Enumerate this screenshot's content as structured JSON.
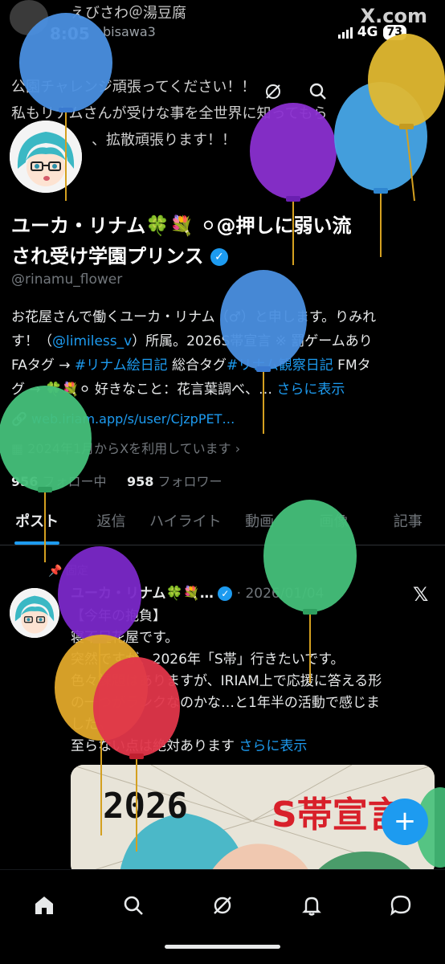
{
  "status_bar": {
    "time": "8:05",
    "network": "4G",
    "battery": "73"
  },
  "banner": {
    "name": "えびさわ＠湯豆腐",
    "handle": "bisawa3",
    "site": "X.com"
  },
  "quote_lines": [
    "公園チャレンジ頑張ってください！！",
    "私もリナムさんが受けな事を全世界に知ってもら",
    "、拡散頑張ります！！"
  ],
  "profile": {
    "name_lines": [
      "ユーカ・リナム🍀💐 ⚪︎@押しに弱い流",
      "され受け学園プリンス"
    ],
    "handle": "@rinamu_flower",
    "bio": {
      "line1": "お花屋さんで働くユーカ・リナム（♂）と申します。りみれ",
      "line2a": "す！（",
      "line2_link": "@limiless_v",
      "line2b": "）所属。2026S帯宣言 ※ 罰ゲームあり",
      "line3a": "FAタグ → ",
      "line3_tag1": "#リナム絵日記",
      "line3b": " 総合タグ",
      "line3_tag2": "#リナム観察日記",
      "line3c": " FMタ",
      "line4a": "グ → 🍀💐⚪︎ 好きなこと：花言葉調べ、… ",
      "more": "さらに表示"
    },
    "url": "web.iriam.app/s/user/CjzpPET…",
    "joined": "2024年1月からXを利用しています",
    "following_count": "956",
    "following_label": "フォロー中",
    "followers_count": "958",
    "followers_label": "フォロワー"
  },
  "tabs": [
    "ポスト",
    "返信",
    "ハイライト",
    "動画",
    "画像",
    "記事"
  ],
  "post": {
    "pinned_label": "固定",
    "author": "ユーカ・リナム🍀💐…",
    "date": "· 2026/01/04",
    "body_lines": [
      "【今年の抱負】",
      "寝不足花屋です。",
      "突然ですが、2026年「S帯」行きたいです。",
      "色々課題はありますが、IRIAM上で応援に答える形",
      "の一つがランクなのかな…と1年半の活動で感じま",
      "した。"
    ],
    "last_line": "至らない点は絶対あります",
    "more": "さらに表示",
    "image_text_left": "2026",
    "image_text_right": "S帯宣言"
  },
  "fab_label": "+",
  "nav_icons": [
    "home-icon",
    "search-icon",
    "grok-icon",
    "notifications-icon",
    "messages-icon"
  ],
  "colors": {
    "accent": "#1d9bf0",
    "background": "#000000",
    "text": "#e7e9ea",
    "secondary": "#71767b"
  },
  "balloon_colors": [
    "#4a8fe0",
    "#8a2fd0",
    "#e0b830",
    "#47a6e8",
    "#45c07a",
    "#7a28c8",
    "#e0a82a",
    "#e0364a"
  ]
}
